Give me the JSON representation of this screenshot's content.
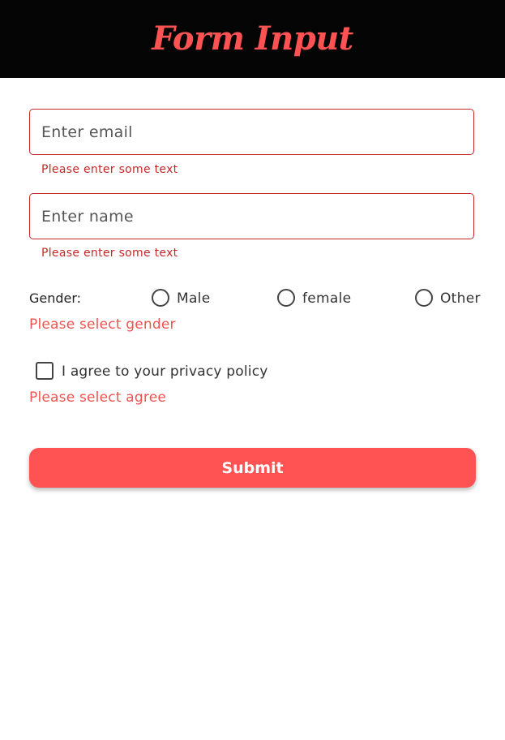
{
  "colors": {
    "app_bar": "#050505",
    "accent": "#ff5252",
    "field_error_border": "#c62828",
    "error_text": "#ef5350"
  },
  "app_bar": {
    "title": "Form Input"
  },
  "form": {
    "email": {
      "value": "",
      "placeholder": "Enter email",
      "error": "Please enter some text"
    },
    "name": {
      "value": "",
      "placeholder": "Enter name",
      "error": "Please enter some text"
    },
    "gender": {
      "label": "Gender:",
      "options": [
        "Male",
        "female",
        "Other"
      ],
      "selected": null,
      "error": "Please select gender"
    },
    "privacy": {
      "label": "I agree to your privacy policy",
      "checked": false,
      "error": "Please select agree"
    },
    "submit_label": "Submit"
  }
}
